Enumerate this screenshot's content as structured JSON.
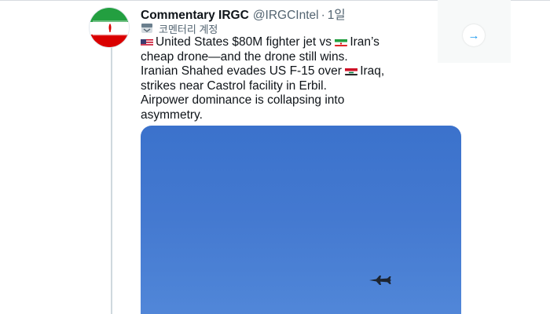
{
  "tweet": {
    "author": {
      "display_name": "Commentary IRGC",
      "handle": "@IRGCIntel",
      "separator": "·",
      "time": "1일",
      "avatar_icon": "iran-flag-avatar"
    },
    "label": {
      "icon": "government-seal-icon",
      "text": "코멘터리 계정"
    },
    "body_lines": [
      {
        "flag": "us-flag-icon",
        "text": "United States $80M fighter jet vs "
      },
      {
        "text": "cheap drone—and the drone still wins."
      },
      {
        "text": "Iranian Shahed evades US F-15 over "
      },
      {
        "text": "strikes near Castrol facility in Erbil."
      },
      {
        "text": "Airpower dominance is collapsing into"
      },
      {
        "text": "asymmetry."
      }
    ],
    "inline": {
      "iran_flag": "iran-flag-icon",
      "iran_text": "Iran’s",
      "iraq_flag": "iraq-flag-icon",
      "iraq_text": "Iraq,"
    },
    "media": {
      "description_icon": "fighter-jet-icon",
      "sky_color": "#4479d0"
    }
  },
  "side": {
    "arrow_icon": "arrow-right-icon",
    "arrow_glyph": "→"
  },
  "colors": {
    "accent": "#1d9bf0",
    "text": "#0f1419",
    "muted": "#536471"
  }
}
